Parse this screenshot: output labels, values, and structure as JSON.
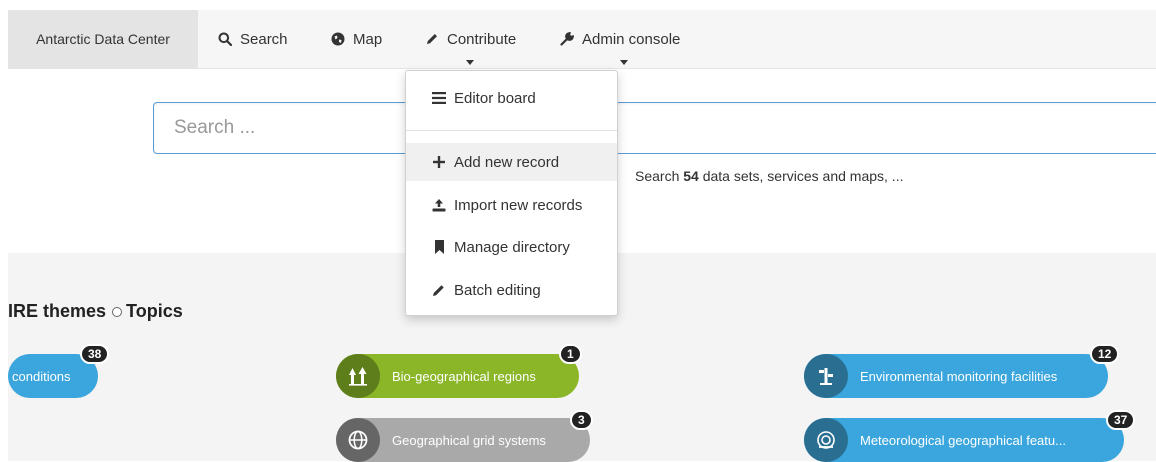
{
  "navbar": {
    "brand": "Antarctic Data Center",
    "items": [
      {
        "label": "Search",
        "icon": "search-icon"
      },
      {
        "label": "Map",
        "icon": "globe-icon"
      },
      {
        "label": "Contribute",
        "icon": "pencil-icon"
      },
      {
        "label": "Admin console",
        "icon": "wrench-icon"
      }
    ]
  },
  "search": {
    "placeholder": "Search ...",
    "hint_prefix": "Search",
    "count": "54",
    "hint_suffix": "data sets, services and maps, ..."
  },
  "themes": {
    "tab_inspire": "IRE themes",
    "tab_topics": "Topics"
  },
  "topics": [
    {
      "label": "conditions",
      "count": "38",
      "color": "#3aa6dd"
    },
    {
      "label": "Bio-geographical regions",
      "count": "1",
      "color": "#8ab627",
      "icon_bg": "#5e7d1b"
    },
    {
      "label": "Environmental monitoring facilities",
      "count": "12",
      "color": "#3aa6dd",
      "icon_bg": "#2a6f92"
    },
    {
      "label": "Geographical grid systems",
      "count": "3",
      "color": "#a9a9a9",
      "icon_bg": "#666666"
    },
    {
      "label": "Meteorological geographical featu...",
      "count": "37",
      "color": "#3aa6dd",
      "icon_bg": "#2a6f92"
    }
  ],
  "contribute_menu": {
    "items": [
      {
        "label": "Editor board",
        "icon": "list-icon"
      },
      {
        "label": "Add new record",
        "icon": "plus-icon"
      },
      {
        "label": "Import new records",
        "icon": "upload-icon"
      },
      {
        "label": "Manage directory",
        "icon": "bookmark-icon"
      },
      {
        "label": "Batch editing",
        "icon": "pencil-icon"
      }
    ]
  }
}
